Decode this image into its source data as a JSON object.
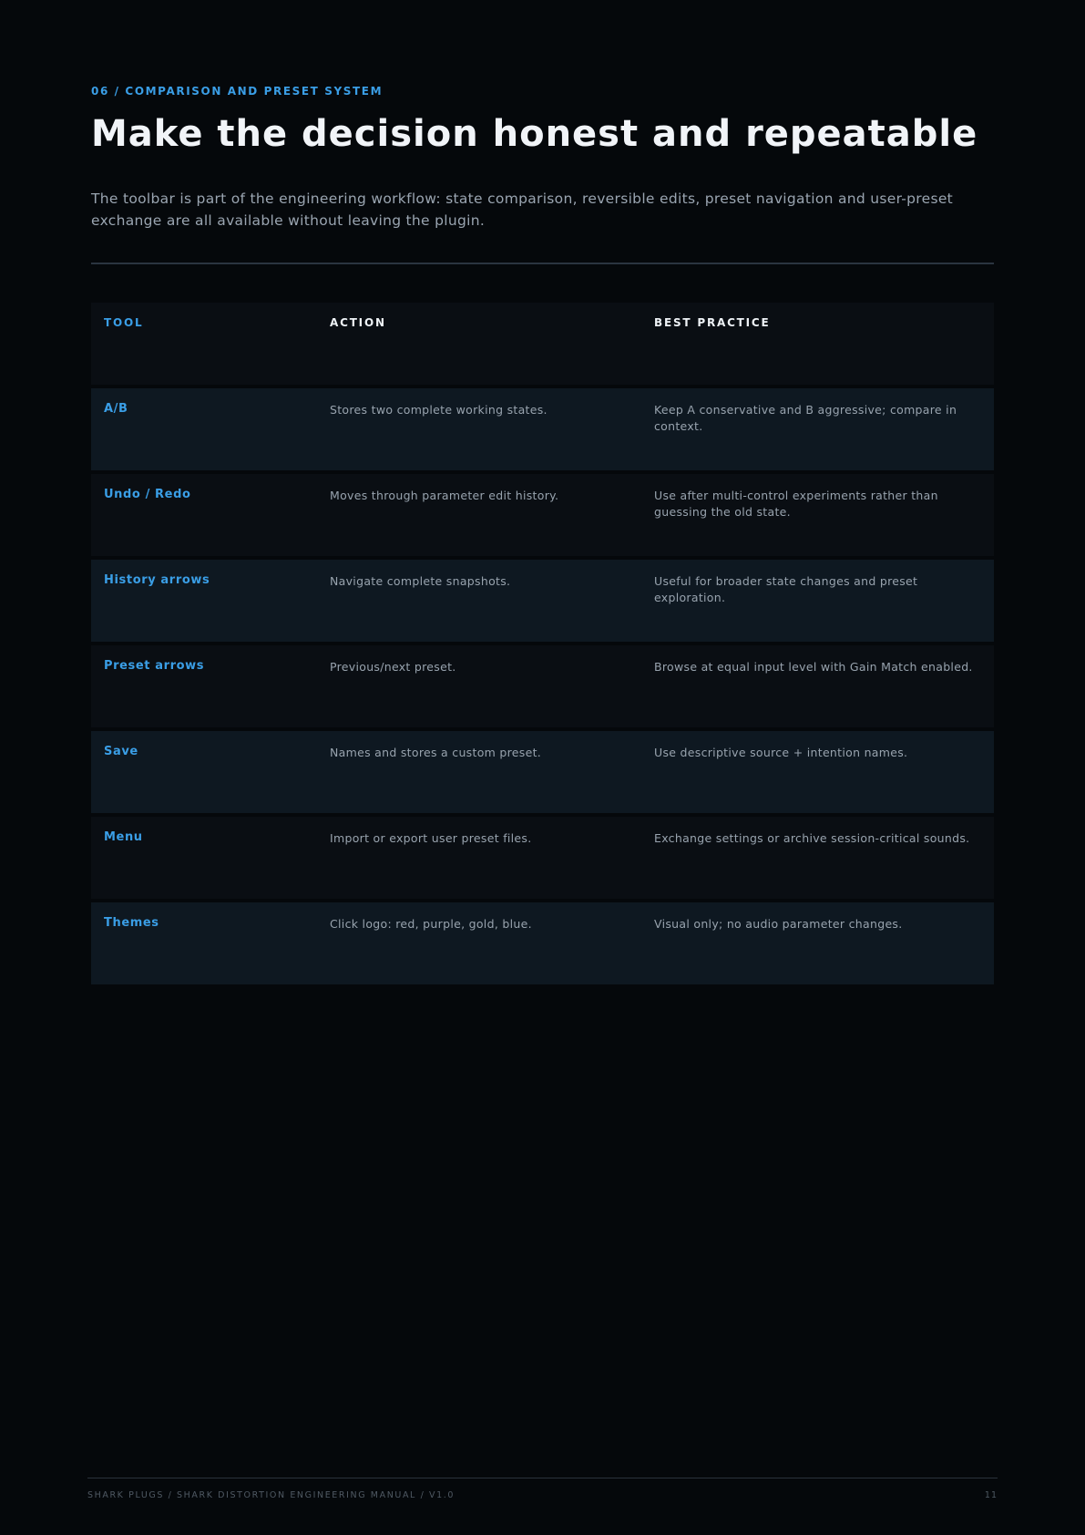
{
  "header": {
    "eyebrow": "06 / COMPARISON AND PRESET SYSTEM",
    "title": "Make the decision honest and repeatable",
    "lede": "The toolbar is part of the engineering workflow: state comparison, reversible edits, preset navigation and user-preset exchange are all available without leaving the plugin."
  },
  "table": {
    "columns": [
      "TOOL",
      "ACTION",
      "BEST PRACTICE"
    ],
    "rows": [
      {
        "tool": "A/B",
        "action": "Stores two complete working states.",
        "practice": "Keep A conservative and B aggressive; compare in context."
      },
      {
        "tool": "Undo / Redo",
        "action": "Moves through parameter edit history.",
        "practice": "Use after multi-control experiments rather than guessing the old state."
      },
      {
        "tool": "History arrows",
        "action": "Navigate complete snapshots.",
        "practice": "Useful for broader state changes and preset exploration."
      },
      {
        "tool": "Preset arrows",
        "action": "Previous/next preset.",
        "practice": "Browse at equal input level with Gain Match enabled."
      },
      {
        "tool": "Save",
        "action": "Names and stores a custom preset.",
        "practice": "Use descriptive source + intention names."
      },
      {
        "tool": "Menu",
        "action": "Import or export user preset files.",
        "practice": "Exchange settings or archive session-critical sounds."
      },
      {
        "tool": "Themes",
        "action": "Click logo: red, purple, gold, blue.",
        "practice": "Visual only; no audio parameter changes."
      }
    ]
  },
  "footer": {
    "left": "SHARK PLUGS  /  SHARK DISTORTION ENGINEERING MANUAL  /  V1.0",
    "page_number": "11"
  },
  "colors": {
    "background": "#05080b",
    "accent": "#3a9ee6",
    "row_dark": "#0a0e13",
    "row_light": "#0e1821"
  }
}
